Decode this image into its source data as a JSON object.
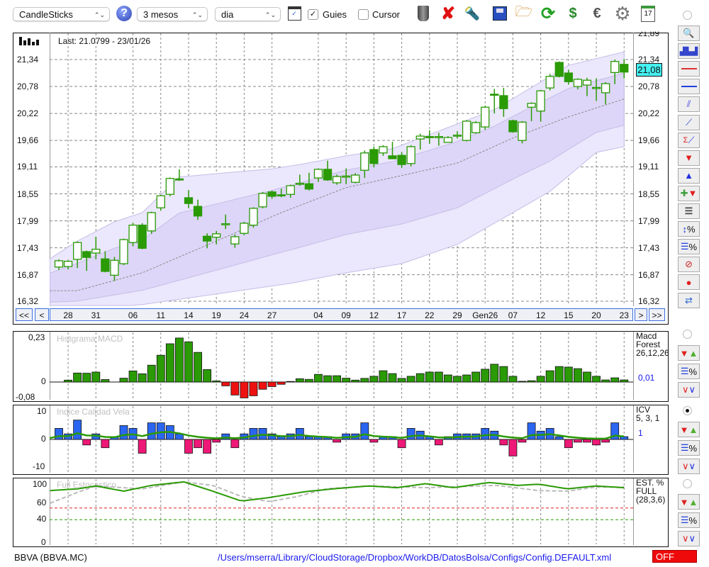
{
  "toolbar": {
    "chart_type": "CandleSticks",
    "period": "3 mesos",
    "interval": "dia",
    "guies_label": "Guies",
    "guies_checked": true,
    "cursor_label": "Cursor",
    "cursor_checked": false,
    "icons": [
      "help-icon",
      "chart-window-icon",
      "trash-icon",
      "delete-icon",
      "flashlight-icon",
      "save-icon",
      "folder-icon",
      "refresh-icon",
      "refresh-dollar-icon",
      "euro-icon",
      "gear-icon",
      "calendar-icon"
    ],
    "calendar_day": "17"
  },
  "main_chart": {
    "last_label": "Last: 21.0799 - 23/01/26",
    "price_tag": "21,08",
    "price_ticks": [
      {
        "label": "21,89",
        "v": 21.89
      },
      {
        "label": "21,34",
        "v": 21.34
      },
      {
        "label": "20,78",
        "v": 20.78
      },
      {
        "label": "20,22",
        "v": 20.22
      },
      {
        "label": "19,66",
        "v": 19.66
      },
      {
        "label": "19,11",
        "v": 19.11
      },
      {
        "label": "18,55",
        "v": 18.55
      },
      {
        "label": "17,99",
        "v": 17.99
      },
      {
        "label": "17,43",
        "v": 17.43
      },
      {
        "label": "16,87",
        "v": 16.87
      },
      {
        "label": "16,32",
        "v": 16.32
      }
    ],
    "colors": {
      "candle": "#2a9a05",
      "band_outer": "#ebe7fc",
      "band_inner": "#ddd6f8",
      "band_line": "#c5bde6",
      "ma": "#8a8a8a",
      "tag": "#44f0f0"
    }
  },
  "nav": {
    "first": "<<",
    "prev": "<",
    "next": ">",
    "last": ">>"
  },
  "chart_data": {
    "type": "candlestick",
    "dates": [
      {
        "label": "28",
        "i": 1
      },
      {
        "label": "31",
        "i": 4
      },
      {
        "label": "06",
        "i": 8
      },
      {
        "label": "11",
        "i": 11
      },
      {
        "label": "14",
        "i": 14
      },
      {
        "label": "19",
        "i": 17
      },
      {
        "label": "24",
        "i": 20
      },
      {
        "label": "27",
        "i": 23
      },
      {
        "label": "04",
        "i": 28
      },
      {
        "label": "09",
        "i": 31
      },
      {
        "label": "12",
        "i": 34
      },
      {
        "label": "17",
        "i": 37
      },
      {
        "label": "22",
        "i": 40
      },
      {
        "label": "29",
        "i": 43
      },
      {
        "label": "Gen26",
        "i": 46
      },
      {
        "label": "07",
        "i": 49
      },
      {
        "label": "12",
        "i": 52
      },
      {
        "label": "15",
        "i": 55
      },
      {
        "label": "20",
        "i": 58
      },
      {
        "label": "23",
        "i": 61
      }
    ],
    "ohlc_fields": [
      "open",
      "close",
      "high",
      "low"
    ],
    "candles": [
      [
        17.03,
        17.16,
        17.19,
        16.97
      ],
      [
        17.04,
        17.15,
        17.18,
        16.98
      ],
      [
        17.19,
        17.54,
        17.56,
        17.01
      ],
      [
        17.35,
        17.23,
        17.37,
        16.95
      ],
      [
        17.32,
        17.4,
        17.66,
        17.19
      ],
      [
        17.2,
        16.94,
        17.36,
        16.92
      ],
      [
        16.86,
        17.17,
        17.24,
        16.74
      ],
      [
        17.1,
        17.6,
        17.62,
        17.07
      ],
      [
        17.54,
        17.9,
        17.95,
        17.46
      ],
      [
        17.9,
        17.42,
        17.94,
        17.4
      ],
      [
        17.78,
        18.16,
        18.18,
        17.72
      ],
      [
        18.26,
        18.51,
        18.53,
        18.2
      ],
      [
        18.54,
        18.87,
        18.89,
        18.5
      ],
      [
        18.86,
        18.85,
        19.06,
        18.82
      ],
      [
        18.47,
        18.35,
        18.63,
        18.25
      ],
      [
        18.29,
        18.09,
        18.43,
        18.01
      ],
      [
        17.67,
        17.57,
        17.73,
        17.42
      ],
      [
        17.65,
        17.72,
        17.78,
        17.5
      ],
      [
        17.92,
        17.93,
        18.12,
        17.82
      ],
      [
        17.51,
        17.66,
        17.71,
        17.43
      ],
      [
        17.73,
        17.94,
        17.97,
        17.69
      ],
      [
        17.9,
        18.25,
        18.27,
        17.85
      ],
      [
        18.28,
        18.56,
        18.59,
        18.25
      ],
      [
        18.59,
        18.5,
        18.62,
        18.45
      ],
      [
        18.53,
        18.52,
        18.66,
        18.48
      ],
      [
        18.54,
        18.72,
        18.74,
        18.47
      ],
      [
        18.76,
        18.77,
        18.95,
        18.72
      ],
      [
        18.76,
        18.65,
        18.99,
        18.62
      ],
      [
        18.88,
        19.06,
        19.08,
        18.8
      ],
      [
        19.06,
        18.84,
        19.24,
        18.82
      ],
      [
        18.78,
        18.91,
        18.95,
        18.74
      ],
      [
        18.91,
        18.92,
        19.08,
        18.75
      ],
      [
        18.79,
        18.94,
        18.98,
        18.77
      ],
      [
        19.04,
        19.4,
        19.45,
        18.88
      ],
      [
        19.47,
        19.18,
        19.53,
        19.1
      ],
      [
        19.4,
        19.53,
        19.56,
        19.34
      ],
      [
        19.34,
        19.28,
        19.63,
        19.27
      ],
      [
        19.35,
        19.16,
        19.42,
        19.09
      ],
      [
        19.18,
        19.53,
        19.56,
        19.12
      ],
      [
        19.69,
        19.75,
        19.8,
        19.47
      ],
      [
        19.74,
        19.73,
        19.87,
        19.59
      ],
      [
        19.73,
        19.74,
        19.82,
        19.55
      ],
      [
        19.62,
        19.72,
        19.75,
        19.61
      ],
      [
        19.76,
        19.77,
        19.85,
        19.7
      ],
      [
        19.66,
        20.06,
        20.08,
        19.64
      ],
      [
        19.82,
        20.03,
        20.06,
        19.8
      ],
      [
        19.94,
        20.35,
        20.38,
        19.88
      ],
      [
        20.62,
        20.6,
        20.73,
        20.22
      ],
      [
        20.59,
        20.32,
        20.75,
        20.15
      ],
      [
        20.07,
        19.84,
        20.09,
        19.82
      ],
      [
        19.66,
        20.04,
        20.06,
        19.6
      ],
      [
        20.35,
        20.43,
        20.45,
        20.06
      ],
      [
        20.27,
        20.69,
        20.71,
        20.05
      ],
      [
        20.75,
        20.99,
        21.04,
        20.7
      ],
      [
        21.28,
        20.99,
        21.3,
        20.97
      ],
      [
        21.06,
        20.88,
        21.13,
        20.82
      ],
      [
        20.78,
        20.93,
        20.95,
        20.72
      ],
      [
        20.81,
        20.91,
        20.96,
        20.58
      ],
      [
        20.75,
        20.76,
        20.95,
        20.48
      ],
      [
        20.65,
        20.84,
        20.87,
        20.41
      ],
      [
        21.07,
        21.3,
        21.34,
        20.83
      ],
      [
        21.24,
        21.08,
        21.35,
        20.95
      ]
    ],
    "band_upper": [
      [
        -1,
        17.2
      ],
      [
        2,
        17.57
      ],
      [
        6,
        17.97
      ],
      [
        9,
        18.16
      ],
      [
        13,
        18.9
      ],
      [
        17,
        18.97
      ],
      [
        23,
        19.07
      ],
      [
        26,
        19.16
      ],
      [
        31,
        19.34
      ],
      [
        36,
        19.49
      ],
      [
        40,
        19.78
      ],
      [
        47,
        20.3
      ],
      [
        55,
        21.22
      ],
      [
        61,
        21.5
      ]
    ],
    "band_lower": [
      [
        -1,
        16.1
      ],
      [
        9,
        16.25
      ],
      [
        17,
        16.47
      ],
      [
        25,
        16.69
      ],
      [
        31,
        16.91
      ],
      [
        37,
        17.1
      ],
      [
        43,
        17.5
      ],
      [
        49,
        18.16
      ],
      [
        53,
        18.6
      ],
      [
        58,
        19.41
      ],
      [
        61,
        19.53
      ]
    ],
    "moving_average": [
      [
        2,
        16.54
      ],
      [
        9,
        16.91
      ],
      [
        17,
        17.57
      ],
      [
        24,
        18.16
      ],
      [
        31,
        18.68
      ],
      [
        37,
        18.93
      ],
      [
        43,
        19.19
      ],
      [
        49,
        19.71
      ],
      [
        55,
        20.15
      ],
      [
        61,
        20.52
      ]
    ],
    "ylim": [
      16.32,
      21.89
    ]
  },
  "macd": {
    "title": "Histgrama MACD",
    "name": "Macd\nForest",
    "params": "26,12,26",
    "value": "0,01",
    "ticks": [
      {
        "label": "0,23",
        "v": 0.23
      },
      {
        "label": "0",
        "v": 0
      },
      {
        "label": "-0,08",
        "v": -0.08
      }
    ],
    "values": [
      0,
      0.01,
      0.047,
      0.046,
      0.052,
      0.013,
      0,
      0.02,
      0.058,
      0.043,
      0.088,
      0.14,
      0.2,
      0.23,
      0.21,
      0.155,
      0.065,
      0.006,
      -0.02,
      -0.068,
      -0.083,
      -0.072,
      -0.038,
      -0.024,
      -0.012,
      0.003,
      0.017,
      0.014,
      0.04,
      0.033,
      0.033,
      0.02,
      0.01,
      0.019,
      0.03,
      0.059,
      0.044,
      0.019,
      0.03,
      0.044,
      0.052,
      0.052,
      0.037,
      0.03,
      0.037,
      0.052,
      0.067,
      0.093,
      0.081,
      0.03,
      0.004,
      0.007,
      0.03,
      0.059,
      0.081,
      0.078,
      0.07,
      0.052,
      0.03,
      0.011,
      0.022,
      0.011
    ],
    "colors": {
      "pos": "#2a9a05",
      "neg": "#ee1111"
    }
  },
  "icv": {
    "title": "Indice Calidad Vela",
    "name": "ICV",
    "params": "5, 3, 1",
    "value": "1",
    "ticks": [
      {
        "label": "10",
        "v": 10
      },
      {
        "label": "0",
        "v": 0
      },
      {
        "label": "-10",
        "v": -10
      }
    ],
    "values": [
      4,
      2,
      7,
      -2,
      2,
      -3,
      1,
      5,
      4,
      -5,
      6,
      6,
      5,
      2,
      -5,
      -3,
      -5,
      -1,
      2,
      -3,
      2,
      4,
      4,
      2,
      1,
      2,
      4,
      1,
      1,
      1,
      -1,
      2,
      2,
      6,
      -1,
      1,
      1,
      -3,
      4,
      3,
      1,
      -2,
      1,
      2,
      2,
      2,
      4,
      3,
      -2,
      -6,
      -1,
      6,
      3,
      4,
      1,
      -3,
      -1,
      -1,
      -2,
      -1,
      6,
      1
    ],
    "colors": {
      "pos": "#2a66f0",
      "neg": "#ee1877",
      "line": "#2a9a05"
    }
  },
  "stoch": {
    "title": "Full Estocastico",
    "name": "EST. %\nFULL",
    "params": "(28,3,6)",
    "ticks": [
      {
        "label": "100",
        "v": 100
      },
      {
        "label": "60",
        "v": 60
      },
      {
        "label": "40",
        "v": 40
      },
      {
        "label": "0",
        "v": 0
      }
    ],
    "k_line": [
      [
        -1,
        90
      ],
      [
        2,
        93
      ],
      [
        4,
        98
      ],
      [
        7,
        89
      ],
      [
        10,
        99
      ],
      [
        13.5,
        105
      ],
      [
        16.6,
        89
      ],
      [
        19.7,
        72
      ],
      [
        22.7,
        78
      ],
      [
        26.5,
        88
      ],
      [
        29.6,
        93
      ],
      [
        33.4,
        98
      ],
      [
        36.5,
        95
      ],
      [
        39.6,
        102
      ],
      [
        42.6,
        95
      ],
      [
        46.4,
        104
      ],
      [
        49.5,
        99
      ],
      [
        51.8,
        101
      ],
      [
        54.9,
        93
      ],
      [
        57.9,
        98
      ],
      [
        61,
        95
      ]
    ],
    "d_line": [
      [
        -1,
        68
      ],
      [
        2,
        87
      ],
      [
        4,
        98
      ],
      [
        9,
        93
      ],
      [
        13.5,
        105
      ],
      [
        16.6,
        99
      ],
      [
        19.7,
        80
      ],
      [
        22.7,
        71
      ],
      [
        25.8,
        80
      ],
      [
        28.8,
        93
      ],
      [
        33.4,
        98
      ],
      [
        39.6,
        95
      ],
      [
        47.2,
        99
      ],
      [
        51.8,
        90
      ],
      [
        54.9,
        89
      ],
      [
        57.9,
        96
      ],
      [
        61,
        96
      ]
    ],
    "levels": [
      60,
      40
    ],
    "colors": {
      "k": "#2a9a05",
      "d": "#bbbbbb",
      "upper": "#dd2222",
      "lower": "#2a9a05"
    }
  },
  "footer": {
    "symbol": "BBVA (BBVA.MC)",
    "path": "/Users/mserra/Library/CloudStorage/Dropbox/WorkDB/DatosBolsa/Configs/Config.DEFAULT.xml",
    "status": "OFF"
  },
  "side_toolbar": {
    "main_icons": [
      "zoom-icon",
      "volume-chart-icon",
      "red-horizontal-line-icon",
      "blue-horizontal-line-icon",
      "channel-icon",
      "trendline-icon",
      "sum-trendline-icon",
      "sell-arrow-icon",
      "buy-arrow-icon",
      "add-signal-icon",
      "grid-lines-icon",
      "percent-range-icon",
      "lines-percent-icon",
      "clear-icon",
      "record-icon",
      "sync-icon"
    ],
    "panel_icons": [
      "signals-icon",
      "lines-percent-icon",
      "oscillator-icon"
    ],
    "selected_panel": 2
  }
}
